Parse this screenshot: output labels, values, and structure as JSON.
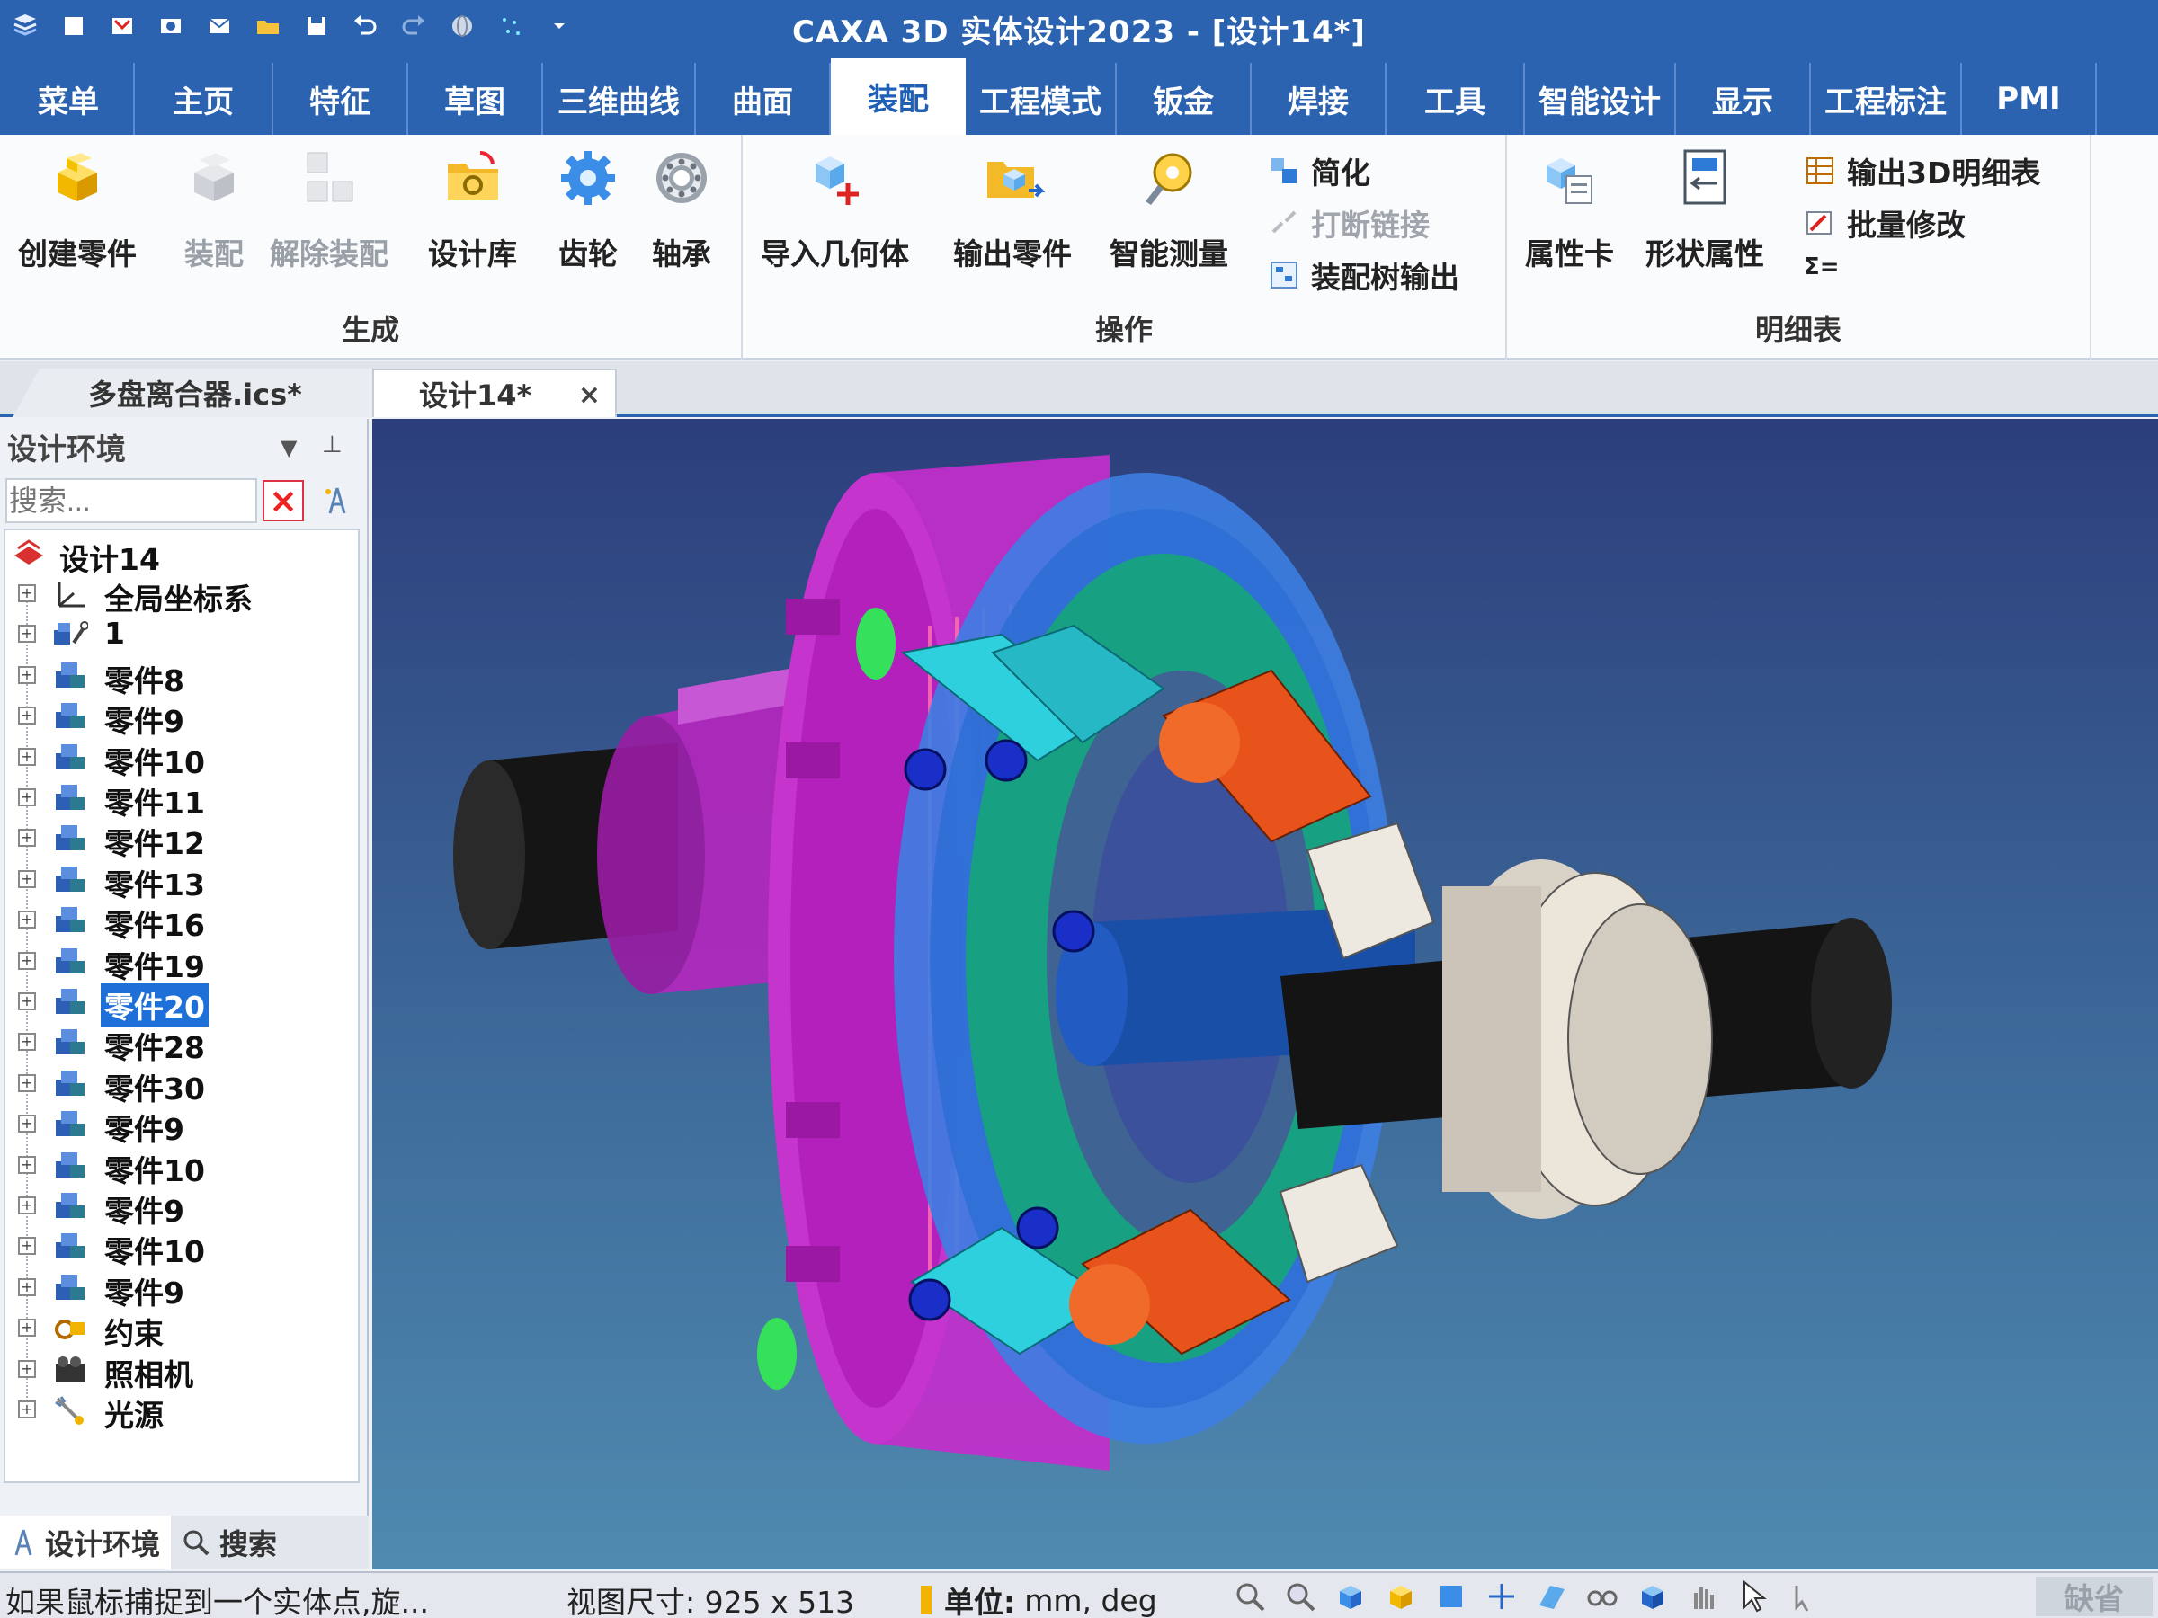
{
  "window": {
    "title": "CAXA 3D 实体设计2023 - [设计14*]"
  },
  "quick_access": [
    "app-menu-icon",
    "new-icon",
    "open-icon",
    "print-icon",
    "mail-icon",
    "folder-icon",
    "save-icon",
    "undo-icon",
    "redo-icon",
    "globe-icon",
    "sparkle-icon",
    "dropdown-icon"
  ],
  "ribbon_tabs": [
    {
      "label": "菜单"
    },
    {
      "label": "主页"
    },
    {
      "label": "特征"
    },
    {
      "label": "草图"
    },
    {
      "label": "三维曲线"
    },
    {
      "label": "曲面"
    },
    {
      "label": "装配",
      "active": true
    },
    {
      "label": "工程模式"
    },
    {
      "label": "钣金"
    },
    {
      "label": "焊接"
    },
    {
      "label": "工具"
    },
    {
      "label": "智能设计"
    },
    {
      "label": "显示"
    },
    {
      "label": "工程标注"
    },
    {
      "label": "PMI"
    }
  ],
  "ribbon": {
    "generate": {
      "title": "生成",
      "create_part": "创建零件",
      "assemble": "装配",
      "disassemble": "解除装配",
      "design_library": "设计库",
      "gear": "齿轮",
      "bearing": "轴承"
    },
    "operate": {
      "title": "操作",
      "import_geometry": "导入几何体",
      "export_part": "输出零件",
      "smart_measure": "智能测量",
      "simplify": "简化",
      "break_link": "打断链接",
      "tree_export": "装配树输出"
    },
    "bom": {
      "title": "明细表",
      "property_card": "属性卡",
      "shape_property": "形状属性",
      "export_3d_bom": "输出3D明细表",
      "batch_modify": "批量修改",
      "sigma": "Σ="
    }
  },
  "doc_tabs": [
    {
      "label": "多盘离合器.ics*"
    },
    {
      "label": "设计14*",
      "close": "×"
    }
  ],
  "panel": {
    "title": "设计环境",
    "search_placeholder": "搜索...",
    "footer_tab_env": "设计环境",
    "footer_tab_search": "搜索"
  },
  "tree": {
    "root": "设计14",
    "items": [
      {
        "label": "全局坐标系",
        "icon": "axes-icon"
      },
      {
        "label": "1",
        "icon": "assembly-icon"
      },
      {
        "label": "零件8",
        "icon": "part-icon"
      },
      {
        "label": "零件9",
        "icon": "part-icon"
      },
      {
        "label": "零件10",
        "icon": "part-icon"
      },
      {
        "label": "零件11",
        "icon": "part-icon"
      },
      {
        "label": "零件12",
        "icon": "part-icon"
      },
      {
        "label": "零件13",
        "icon": "part-icon"
      },
      {
        "label": "零件16",
        "icon": "part-icon"
      },
      {
        "label": "零件19",
        "icon": "part-icon"
      },
      {
        "label": "零件20",
        "icon": "part-icon",
        "selected": true
      },
      {
        "label": "零件28",
        "icon": "part-icon"
      },
      {
        "label": "零件30",
        "icon": "part-icon"
      },
      {
        "label": "零件9",
        "icon": "part-icon"
      },
      {
        "label": "零件10",
        "icon": "part-icon"
      },
      {
        "label": "零件9",
        "icon": "part-icon"
      },
      {
        "label": "零件10",
        "icon": "part-icon"
      },
      {
        "label": "零件9",
        "icon": "part-icon"
      },
      {
        "label": "约束",
        "icon": "constraint-icon"
      },
      {
        "label": "照相机",
        "icon": "camera-icon"
      },
      {
        "label": "光源",
        "icon": "light-icon"
      }
    ]
  },
  "status": {
    "message": "如果鼠标捕捉到一个实体点,旋...",
    "view_size": "视图尺寸: 925 x 513",
    "unit_label": "单位:",
    "unit_value": "mm, deg",
    "default_label": "缺省"
  },
  "colors": {
    "titlebar": "#2b63b0",
    "accent": "#1f6fd8",
    "clutch_housing": "#d23ad6",
    "flange_blue": "#3f86e4",
    "flange_green": "#1fb08a",
    "linkage_orange": "#e8531c",
    "linkage_cyan": "#2fd0de",
    "collar": "#d9d2c6",
    "shaft": "#1b1b1b"
  }
}
